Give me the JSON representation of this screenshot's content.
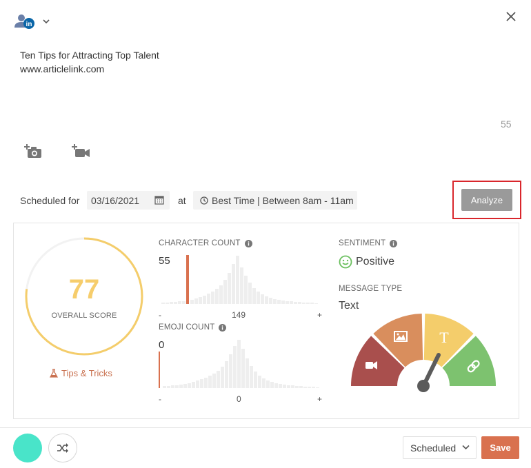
{
  "post": {
    "lines": [
      "Ten Tips for Attracting Top Talent",
      "www.articlelink.com"
    ],
    "char_remaining": "55"
  },
  "icons": {
    "account": "linkedin-account-icon",
    "close": "close-icon",
    "add_photo": "add-photo-icon",
    "add_video": "add-video-icon",
    "calendar": "calendar-icon",
    "clock": "clock-icon"
  },
  "schedule": {
    "label": "Scheduled for",
    "date": "03/16/2021",
    "at_label": "at",
    "time": "Best Time | Between 8am - 11am"
  },
  "analyze_label": "Analyze",
  "analysis": {
    "overall": {
      "score": "77",
      "score_fraction": 0.77,
      "label": "OVERALL SCORE",
      "tips_label": "Tips & Tricks"
    },
    "char_count": {
      "title": "CHARACTER COUNT",
      "value": "55",
      "axis_min": "-",
      "axis_mid": "149",
      "axis_max": "+"
    },
    "emoji_count": {
      "title": "EMOJI COUNT",
      "value": "0",
      "axis_min": "-",
      "axis_mid": "0",
      "axis_max": "+"
    },
    "sentiment": {
      "title": "SENTIMENT",
      "value": "Positive"
    },
    "message_type": {
      "title": "MESSAGE TYPE",
      "value": "Text",
      "gauge_segments": [
        {
          "icon": "video-icon",
          "color": "#a94f4d"
        },
        {
          "icon": "image-icon",
          "color": "#d98e5d"
        },
        {
          "icon": "text-icon",
          "color": "#f4cd6b",
          "glyph": "T"
        },
        {
          "icon": "link-icon",
          "color": "#7dc26f"
        }
      ]
    }
  },
  "footer": {
    "status": "Scheduled",
    "save_label": "Save"
  },
  "colors": {
    "score_ring": "#f4cd6b",
    "accent": "#d9714f",
    "positive": "#6abf5e",
    "avatar": "#49e4c9"
  }
}
